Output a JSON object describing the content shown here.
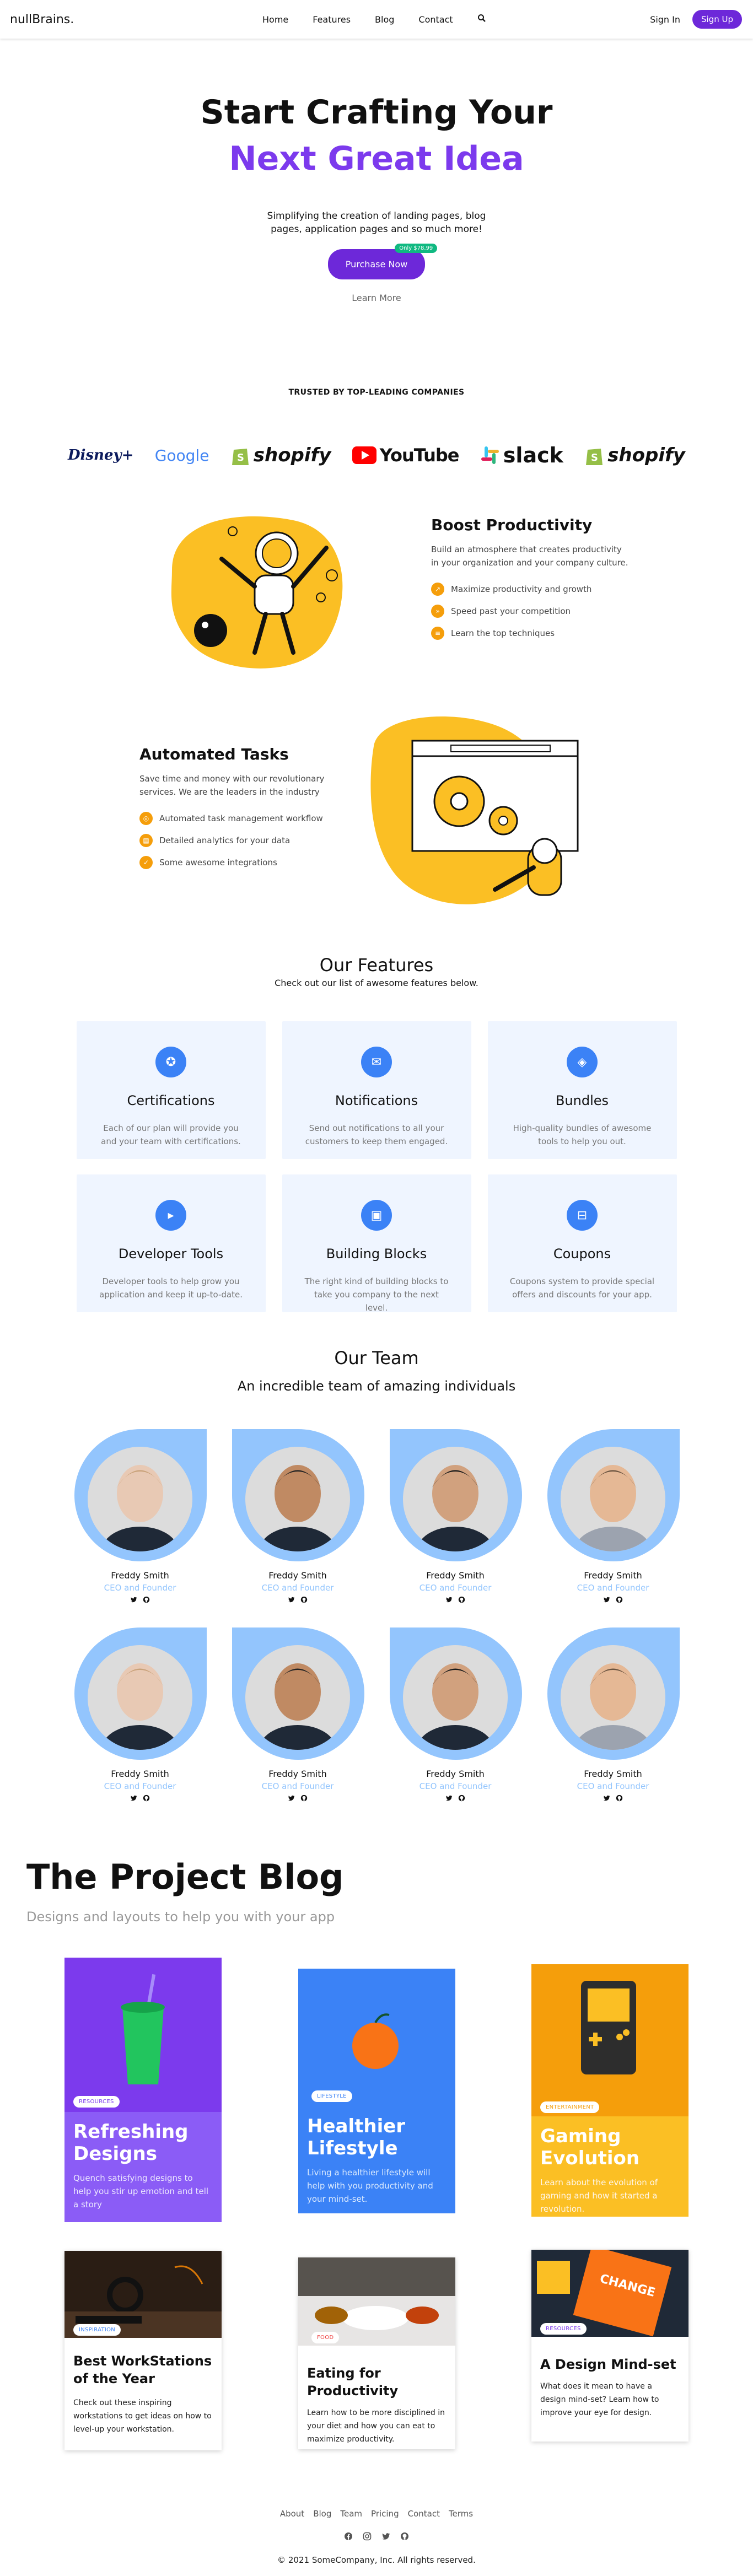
{
  "nav": {
    "brand": "nullBrains.",
    "links": [
      "Home",
      "Features",
      "Blog",
      "Contact"
    ],
    "search_icon": "search-icon",
    "signin": "Sign In",
    "signup": "Sign Up"
  },
  "hero": {
    "line1": "Start Crafting Your",
    "line2": "Next Great Idea",
    "subtitle": "Simplifying the creation of landing pages, blog pages, application pages and so much more!",
    "purchase": "Purchase Now",
    "badge": "Only $78,99",
    "learn_more": "Learn More"
  },
  "trusted": {
    "title": "TRUSTED BY TOP-LEADING COMPANIES",
    "logos": [
      "Disney+",
      "Google",
      "shopify",
      "YouTube",
      "slack",
      "shopify"
    ]
  },
  "productivity": {
    "title": "Boost Productivity",
    "text": "Build an atmosphere that creates productivity in your organization and your company culture.",
    "items": [
      "Maximize productivity and growth",
      "Speed past your competition",
      "Learn the top techniques"
    ]
  },
  "automated": {
    "title": "Automated Tasks",
    "text": "Save time and money with our revolutionary services. We are the leaders in the industry",
    "items": [
      "Automated task management workflow",
      "Detailed analytics for your data",
      "Some awesome integrations"
    ]
  },
  "features": {
    "title": "Our Features",
    "subtitle": "Check out our list of awesome features below.",
    "cards": [
      {
        "title": "Certifications",
        "text": "Each of our plan will provide you and your team with certifications.",
        "icon": "certificate-icon"
      },
      {
        "title": "Notifications",
        "text": "Send out notifications to all your customers to keep them engaged.",
        "icon": "megaphone-icon"
      },
      {
        "title": "Bundles",
        "text": "High-quality bundles of awesome tools to help you out.",
        "icon": "cube-icon"
      },
      {
        "title": "Developer Tools",
        "text": "Developer tools to help grow you application and keep it up-to-date.",
        "icon": "terminal-icon"
      },
      {
        "title": "Building Blocks",
        "text": "The right kind of building blocks to take you company to the next level.",
        "icon": "blocks-icon"
      },
      {
        "title": "Coupons",
        "text": "Coupons system to provide special offers and discounts for your app.",
        "icon": "coupon-icon"
      }
    ]
  },
  "team": {
    "title": "Our Team",
    "subtitle": "An incredible team of amazing individuals",
    "members": [
      {
        "name": "Freddy Smith",
        "role": "CEO and Founder"
      },
      {
        "name": "Freddy Smith",
        "role": "CEO and Founder"
      },
      {
        "name": "Freddy Smith",
        "role": "CEO and Founder"
      },
      {
        "name": "Freddy Smith",
        "role": "CEO and Founder"
      },
      {
        "name": "Freddy Smith",
        "role": "CEO and Founder"
      },
      {
        "name": "Freddy Smith",
        "role": "CEO and Founder"
      },
      {
        "name": "Freddy Smith",
        "role": "CEO and Founder"
      },
      {
        "name": "Freddy Smith",
        "role": "CEO and Founder"
      }
    ]
  },
  "blog": {
    "title": "The Project Blog",
    "subtitle": "Designs and layouts to help you with your app",
    "posts": [
      {
        "tag": "RESOURCES",
        "title": "Refreshing Designs",
        "text": "Quench satisfying designs to help you stir up emotion and tell a story"
      },
      {
        "tag": "LIFESTYLE",
        "title": "Healthier Lifestyle",
        "text": "Living a healthier lifestyle will help with you productivity and your mind-set."
      },
      {
        "tag": "ENTERTAINMENT",
        "title": "Gaming Evolution",
        "text": "Learn about the evolution of gaming and how it started a revolution."
      },
      {
        "tag": "INSPIRATION",
        "title": "Best WorkStations of the Year",
        "text": "Check out these inspiring workstations to get ideas on how to level-up your workstation."
      },
      {
        "tag": "FOOD",
        "title": "Eating for Productivity",
        "text": "Learn how to be more disciplined in your diet and how you can eat to maximize productivity."
      },
      {
        "tag": "RESOURCES",
        "title": "A Design Mind-set",
        "text": "What does it mean to have a design mind-set? Learn how to improve your eye for design."
      }
    ]
  },
  "footer": {
    "links": [
      "About",
      "Blog",
      "Team",
      "Pricing",
      "Contact",
      "Terms"
    ],
    "copyright": "© 2021 SomeCompany, Inc. All rights reserved."
  },
  "colors": {
    "accent": "#7c3aed",
    "blue": "#3b82f6",
    "yellow": "#fbbf24"
  }
}
